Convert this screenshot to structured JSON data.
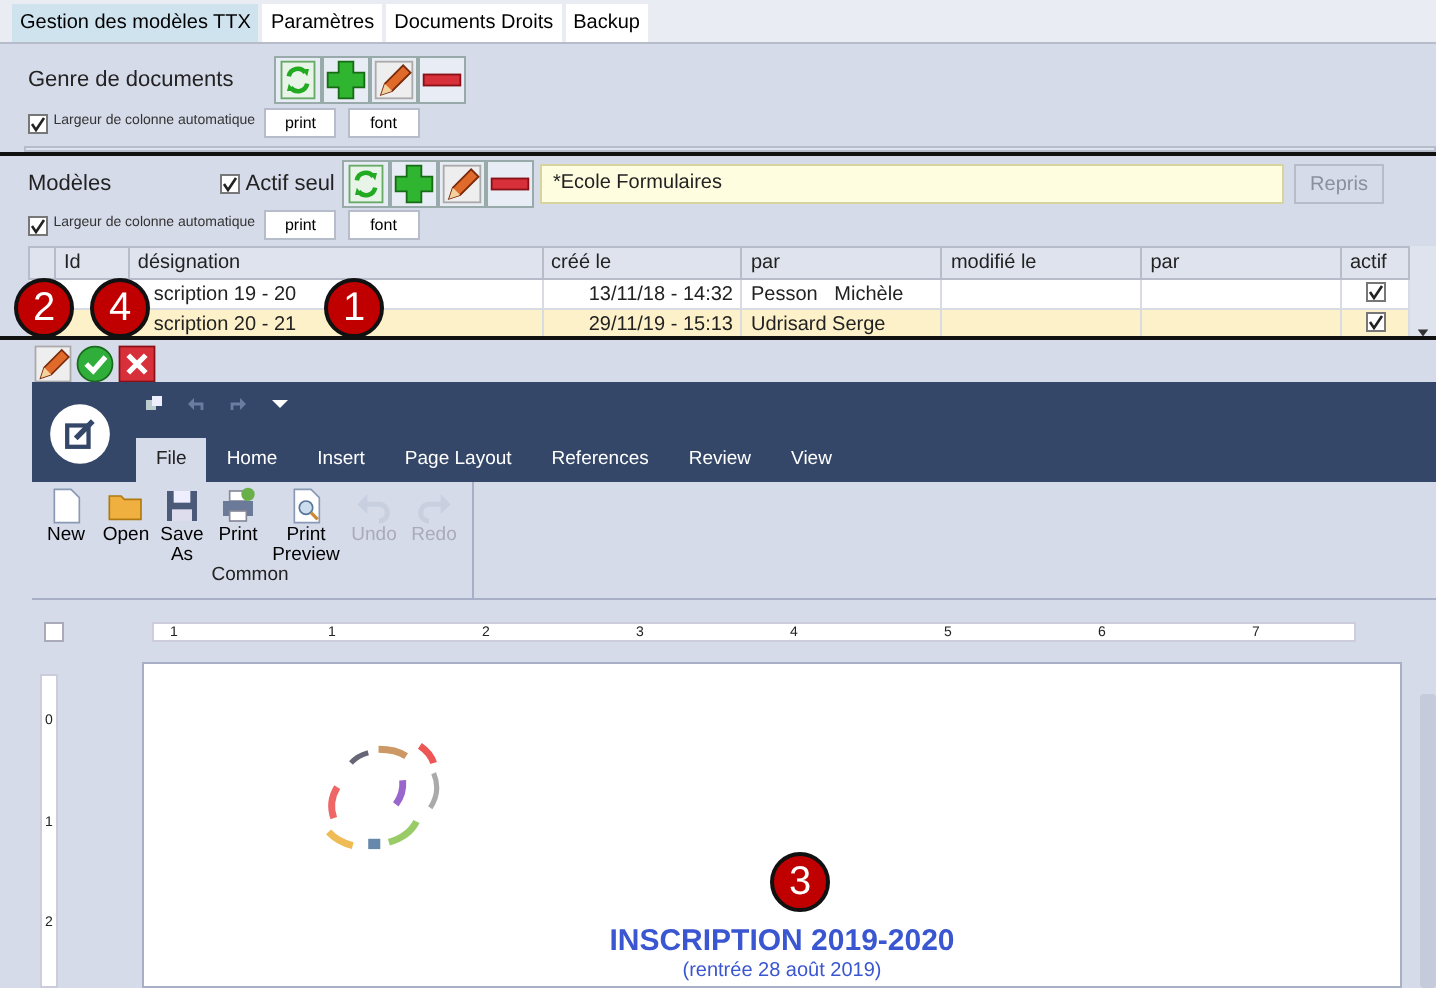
{
  "tabs": [
    {
      "label": "Gestion des modèles TTX",
      "selected": true
    },
    {
      "label": "Paramètres",
      "selected": false
    },
    {
      "label": "Documents Droits",
      "selected": false
    },
    {
      "label": "Backup",
      "selected": false
    }
  ],
  "genre": {
    "title": "Genre de documents",
    "auto_width": {
      "label": "Largeur de colonne automatique",
      "checked": true
    },
    "buttons": [
      "print",
      "font"
    ]
  },
  "modeles": {
    "title": "Modèles",
    "active_only": {
      "label": "Actif seul",
      "checked": true
    },
    "filter_value": "*Ecole Formulaires",
    "reprise_button": {
      "label": "Repris",
      "disabled": true
    },
    "auto_width": {
      "label": "Largeur de colonne automatique",
      "checked": true
    },
    "buttons": [
      "print",
      "font"
    ],
    "table": {
      "columns": [
        "Id",
        "désignation",
        "créé le",
        "par",
        "modifié le",
        "par",
        "actif"
      ],
      "rows": [
        {
          "designation": "scription 19 - 20",
          "created": "13/11/18 - 14:32",
          "created_by": "Pesson   Michèle",
          "active": true,
          "selected": false
        },
        {
          "designation": "scription 20 - 21",
          "created": "29/11/19 - 15:13",
          "created_by": "Udrisard Serge",
          "active": true,
          "selected": true
        }
      ]
    }
  },
  "editor": {
    "ribbon_tabs": [
      {
        "label": "File",
        "selected": true
      },
      {
        "label": "Home",
        "selected": false
      },
      {
        "label": "Insert",
        "selected": false
      },
      {
        "label": "Page Layout",
        "selected": false
      },
      {
        "label": "References",
        "selected": false
      },
      {
        "label": "Review",
        "selected": false
      },
      {
        "label": "View",
        "selected": false
      }
    ],
    "commands": [
      {
        "label": "New",
        "kind": "new",
        "disabled": false
      },
      {
        "label": "Open",
        "kind": "open",
        "disabled": false
      },
      {
        "label": "Save As",
        "kind": "save",
        "disabled": false
      },
      {
        "label": "Print",
        "kind": "print",
        "disabled": false
      },
      {
        "label": "Print Preview",
        "kind": "preview",
        "disabled": false
      },
      {
        "label": "Undo",
        "kind": "undo",
        "disabled": true
      },
      {
        "label": "Redo",
        "kind": "redo",
        "disabled": true
      }
    ],
    "group_label": "Common",
    "ruler": [
      "1",
      "1",
      "2",
      "3",
      "4",
      "5",
      "6",
      "7"
    ],
    "vertical_ruler": [
      "0",
      "1",
      "2"
    ],
    "document": {
      "title": "INSCRIPTION 2019-2020",
      "subtitle": "(rentrée 28 août 2019)"
    }
  },
  "callouts": [
    "2",
    "4",
    "1",
    "3"
  ]
}
